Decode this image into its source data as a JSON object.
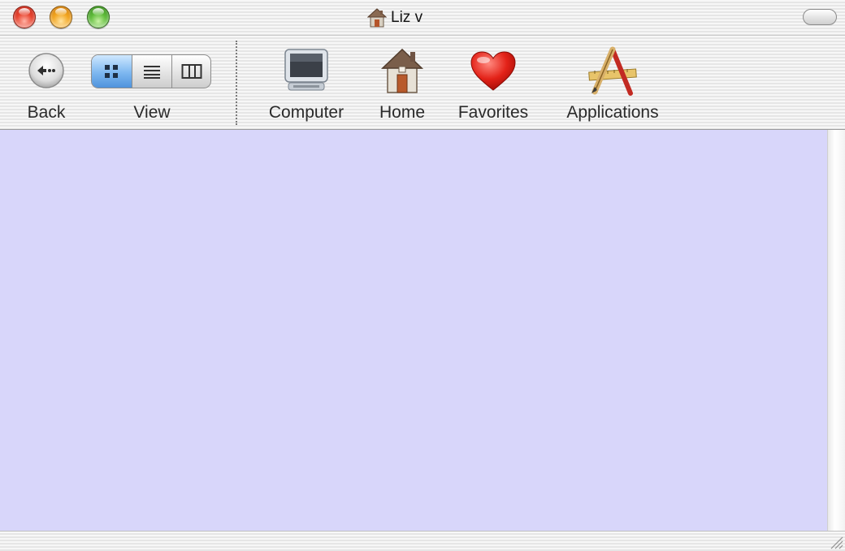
{
  "window": {
    "title": "Liz v",
    "title_icon": "home-icon",
    "background_color": "#d8d6fa"
  },
  "window_controls": {
    "close_color": "#e8442f",
    "minimize_color": "#f2a51f",
    "zoom_color": "#5fbc3a"
  },
  "toolbar": {
    "back": {
      "label": "Back",
      "icon": "back-arrow-icon"
    },
    "view": {
      "label": "View",
      "modes": [
        {
          "name": "icon-view",
          "selected": true
        },
        {
          "name": "list-view",
          "selected": false
        },
        {
          "name": "column-view",
          "selected": false
        }
      ]
    },
    "items": [
      {
        "label": "Computer",
        "icon": "computer-icon"
      },
      {
        "label": "Home",
        "icon": "home-icon"
      },
      {
        "label": "Favorites",
        "icon": "heart-icon"
      },
      {
        "label": "Applications",
        "icon": "applications-icon"
      }
    ]
  }
}
